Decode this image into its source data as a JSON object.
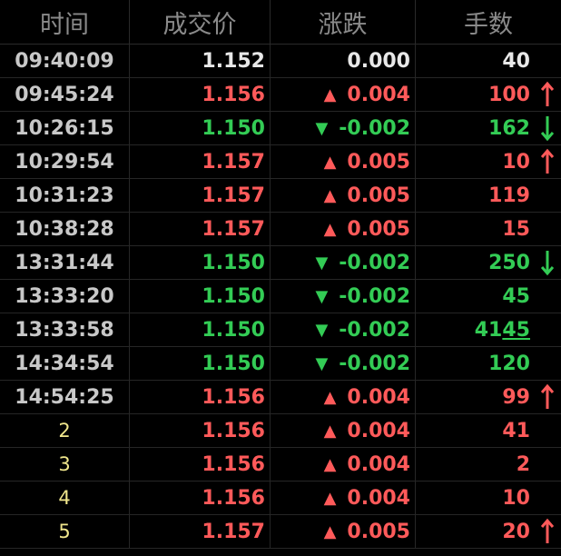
{
  "header": {
    "time": "时间",
    "price": "成交价",
    "change": "涨跌",
    "volume": "手数"
  },
  "colors": {
    "up": "#ff5a5a",
    "down": "#33cc55",
    "flat": "#e8e8e8",
    "index": "#f0e68c"
  },
  "rows": [
    {
      "time": "09:40:09",
      "price": "1.152",
      "change": "0.000",
      "volume": "40",
      "dir": "flat",
      "arrow": "none"
    },
    {
      "time": "09:45:24",
      "price": "1.156",
      "change": "0.004",
      "volume": "100",
      "dir": "up",
      "arrow": "up"
    },
    {
      "time": "10:26:15",
      "price": "1.150",
      "change": "-0.002",
      "volume": "162",
      "dir": "down",
      "arrow": "down"
    },
    {
      "time": "10:29:54",
      "price": "1.157",
      "change": "0.005",
      "volume": "10",
      "dir": "up",
      "arrow": "up"
    },
    {
      "time": "10:31:23",
      "price": "1.157",
      "change": "0.005",
      "volume": "119",
      "dir": "up",
      "arrow": "none"
    },
    {
      "time": "10:38:28",
      "price": "1.157",
      "change": "0.005",
      "volume": "15",
      "dir": "up",
      "arrow": "none"
    },
    {
      "time": "13:31:44",
      "price": "1.150",
      "change": "-0.002",
      "volume": "250",
      "dir": "down",
      "arrow": "down"
    },
    {
      "time": "13:33:20",
      "price": "1.150",
      "change": "-0.002",
      "volume": "45",
      "dir": "down",
      "arrow": "none"
    },
    {
      "time": "13:33:58",
      "price": "1.150",
      "change": "-0.002",
      "volume": "4145",
      "dir": "down",
      "arrow": "none",
      "underline": "45"
    },
    {
      "time": "14:34:54",
      "price": "1.150",
      "change": "-0.002",
      "volume": "120",
      "dir": "down",
      "arrow": "none"
    },
    {
      "time": "14:54:25",
      "price": "1.156",
      "change": "0.004",
      "volume": "99",
      "dir": "up",
      "arrow": "up"
    },
    {
      "time": "2",
      "price": "1.156",
      "change": "0.004",
      "volume": "41",
      "dir": "up",
      "arrow": "none",
      "index": true
    },
    {
      "time": "3",
      "price": "1.156",
      "change": "0.004",
      "volume": "2",
      "dir": "up",
      "arrow": "none",
      "index": true
    },
    {
      "time": "4",
      "price": "1.156",
      "change": "0.004",
      "volume": "10",
      "dir": "up",
      "arrow": "none",
      "index": true
    },
    {
      "time": "5",
      "price": "1.157",
      "change": "0.005",
      "volume": "20",
      "dir": "up",
      "arrow": "up",
      "index": true
    }
  ]
}
